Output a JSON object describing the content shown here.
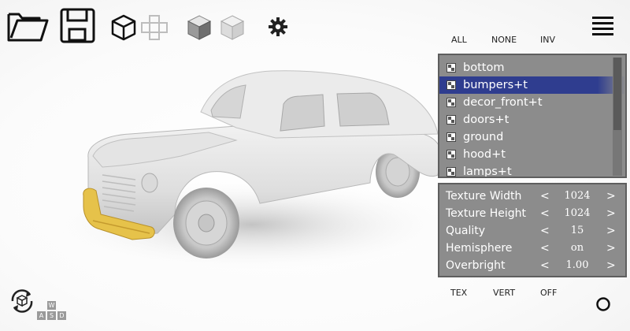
{
  "toolbar": {
    "icons": [
      "open-folder-icon",
      "save-icon",
      "cube-outline-icon",
      "cross-outline-icon",
      "cube-shaded-icon",
      "cube-light-icon",
      "gear-icon",
      "hamburger-menu-icon"
    ]
  },
  "selection": {
    "all": "ALL",
    "none": "NONE",
    "inv": "INV"
  },
  "layers": {
    "items": [
      {
        "label": "bottom",
        "selected": false
      },
      {
        "label": "bumpers+t",
        "selected": true
      },
      {
        "label": "decor_front+t",
        "selected": false
      },
      {
        "label": "doors+t",
        "selected": false
      },
      {
        "label": "ground",
        "selected": false
      },
      {
        "label": "hood+t",
        "selected": false
      },
      {
        "label": "lamps+t",
        "selected": false
      }
    ]
  },
  "settings": {
    "rows": [
      {
        "label": "Texture Width",
        "prev": "<",
        "value": "1024",
        "next": ">"
      },
      {
        "label": "Texture Height",
        "prev": "<",
        "value": "1024",
        "next": ">"
      },
      {
        "label": "Quality",
        "prev": "<",
        "value": "15",
        "next": ">"
      },
      {
        "label": "Hemisphere",
        "prev": "<",
        "value": "on",
        "next": ">"
      },
      {
        "label": "Overbright",
        "prev": "<",
        "value": "1.00",
        "next": ">"
      }
    ]
  },
  "modes": {
    "tex": "TEX",
    "vert": "VERT",
    "off": "OFF"
  },
  "nav": {
    "keys": [
      "W",
      "A",
      "S",
      "D"
    ]
  },
  "colors": {
    "highlight": "#e6c24a",
    "panel": "#8c8c8c",
    "selected_row": "#2f3d8f"
  }
}
